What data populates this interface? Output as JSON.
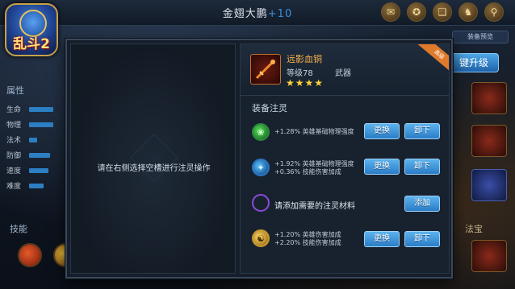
{
  "header": {
    "hero_name": "金翅大鹏",
    "hero_level": "+10",
    "icons": [
      "scroll-icon",
      "compass-icon",
      "book-icon",
      "armor-icon",
      "magnifier-icon"
    ]
  },
  "app": {
    "brand": "乱斗2"
  },
  "stats": {
    "heading": "属性",
    "rows": [
      {
        "label": "生命",
        "fill": 0.55
      },
      {
        "label": "物理",
        "fill": 0.55
      },
      {
        "label": "法术",
        "fill": 0.2
      },
      {
        "label": "防御",
        "fill": 0.5
      },
      {
        "label": "速度",
        "fill": 0.45
      },
      {
        "label": "难度",
        "fill": 0.35
      }
    ]
  },
  "skills": {
    "heading": "技能"
  },
  "right_panel": {
    "tab": "装备预览",
    "upgrade_label": "键升级",
    "treasure_label": "法宝"
  },
  "dialog": {
    "left_message": "请在右侧选择空槽进行注灵操作",
    "item": {
      "name": "远影血铜",
      "level": "等级78",
      "type": "武器",
      "stars": "★★★★",
      "ribbon": "高级"
    },
    "section_title": "装备注灵",
    "slots": [
      {
        "orb": "green",
        "lines": [
          "+1.28% 英雄基础物理强度"
        ],
        "buttons": [
          "更换",
          "卸下"
        ]
      },
      {
        "orb": "blue",
        "lines": [
          "+1.92% 英雄基础物理强度",
          "+0.36% 技能伤害加成"
        ],
        "buttons": [
          "更换",
          "卸下"
        ]
      },
      {
        "orb": "purple",
        "hint": "请添加需要的注灵材料",
        "buttons": [
          "添加"
        ]
      },
      {
        "orb": "gold",
        "lines": [
          "+1.20% 英雄伤害加成",
          "+2.20% 技能伤害加成"
        ],
        "buttons": [
          "更换",
          "卸下"
        ]
      }
    ]
  },
  "colors": {
    "accent_blue": "#2a7cc6",
    "item_name_orange": "#ffb24a",
    "star_gold": "#ffd23a",
    "panel_bg": "#151e2a"
  }
}
